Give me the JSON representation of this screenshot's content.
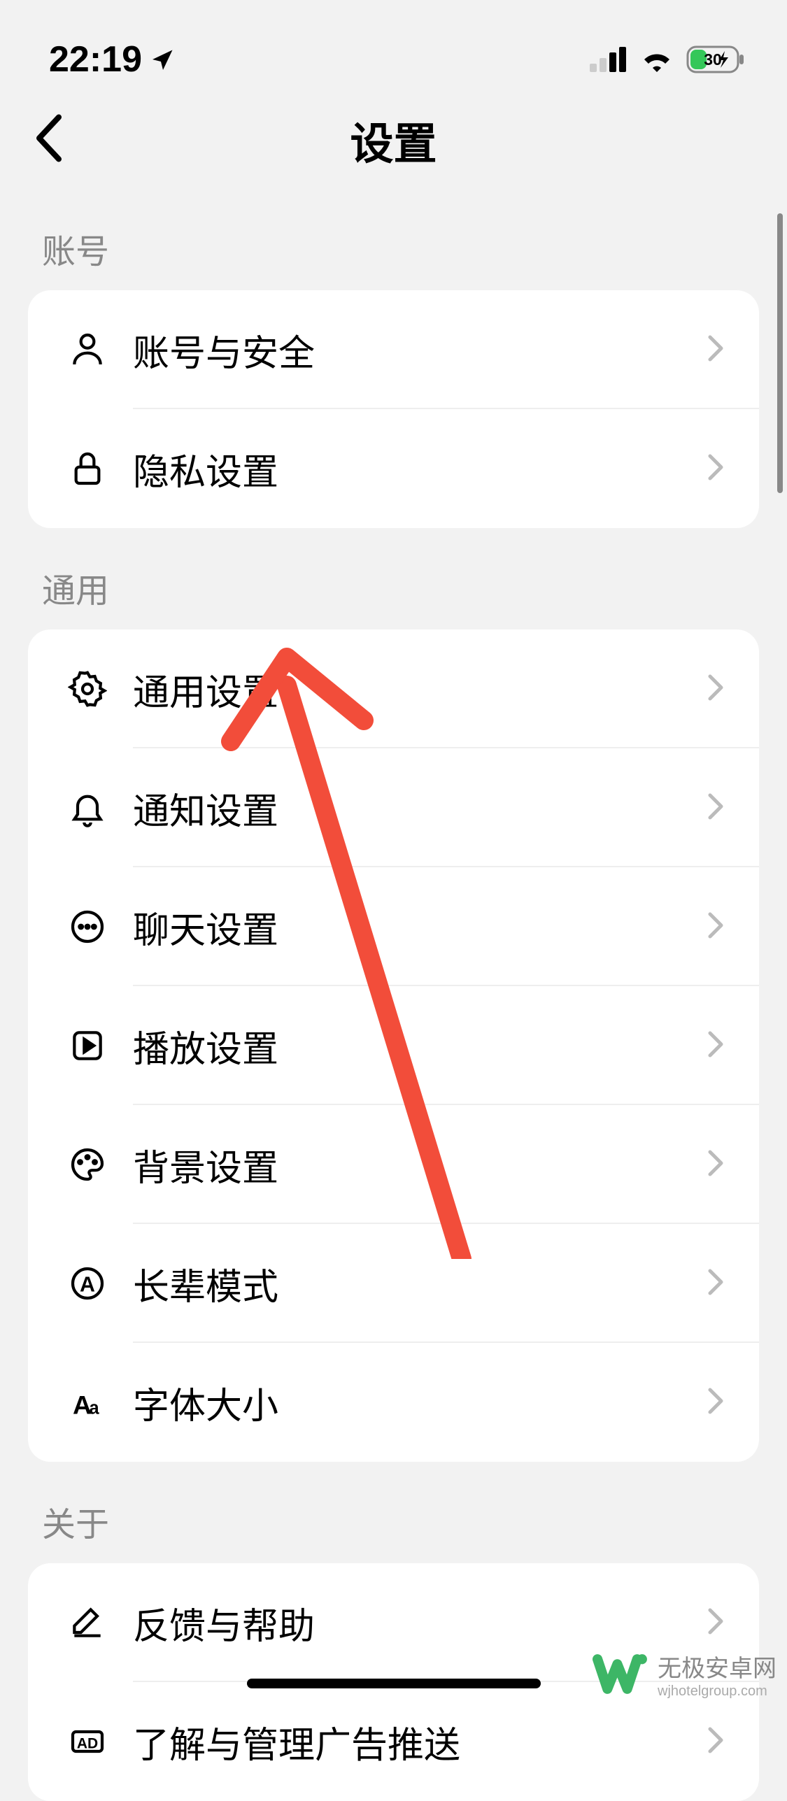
{
  "statusBar": {
    "time": "22:19",
    "batteryPercent": "30"
  },
  "nav": {
    "title": "设置"
  },
  "sections": [
    {
      "header": "账号",
      "items": [
        {
          "icon": "user",
          "label": "账号与安全"
        },
        {
          "icon": "lock",
          "label": "隐私设置"
        }
      ]
    },
    {
      "header": "通用",
      "items": [
        {
          "icon": "gear",
          "label": "通用设置"
        },
        {
          "icon": "bell",
          "label": "通知设置"
        },
        {
          "icon": "chat",
          "label": "聊天设置"
        },
        {
          "icon": "play",
          "label": "播放设置"
        },
        {
          "icon": "palette",
          "label": "背景设置"
        },
        {
          "icon": "elder",
          "label": "长辈模式"
        },
        {
          "icon": "font",
          "label": "字体大小"
        }
      ]
    },
    {
      "header": "关于",
      "items": [
        {
          "icon": "pencil",
          "label": "反馈与帮助"
        },
        {
          "icon": "ad",
          "label": "了解与管理广告推送"
        }
      ]
    }
  ],
  "watermark": {
    "cn": "无极安卓网",
    "en": "wjhotelgroup.com"
  }
}
